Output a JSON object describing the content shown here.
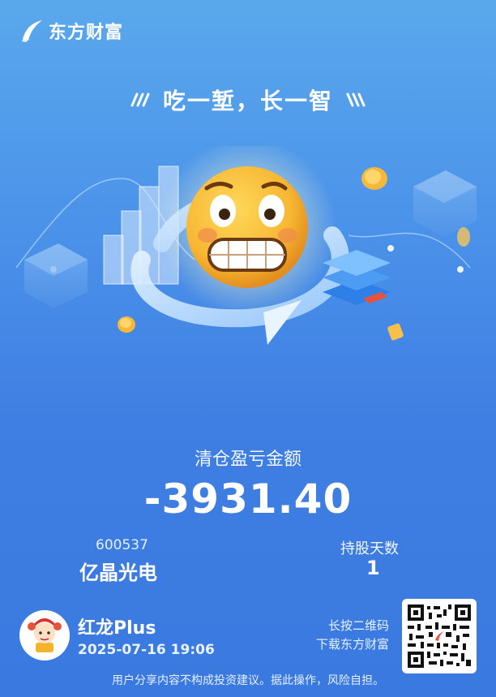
{
  "brand": {
    "name": "东方财富"
  },
  "slogan": "吃一堑，长一智",
  "result": {
    "label": "清仓盈亏金额",
    "value": "-3931.40"
  },
  "stock": {
    "code": "600537",
    "name": "亿晶光电"
  },
  "holding": {
    "label": "持股天数",
    "days": "1"
  },
  "user": {
    "name": "红龙Plus",
    "datetime": "2025-07-16 19:06"
  },
  "qr": {
    "hint_line1": "长按二维码",
    "hint_line2": "下载东方财富"
  },
  "footer": {
    "disclaimer": "用户分享内容不构成投资建议。据此操作，风险自担。"
  },
  "colors": {
    "background": "#4c94ea",
    "emoji": "#f7b733",
    "accent_red": "#e8513b"
  },
  "icons": [
    "brand-logo-icon",
    "grimace-emoji-icon",
    "circular-arrow-icon",
    "layers-icon",
    "coin-icon",
    "avatar-icon",
    "qr-code-icon"
  ]
}
